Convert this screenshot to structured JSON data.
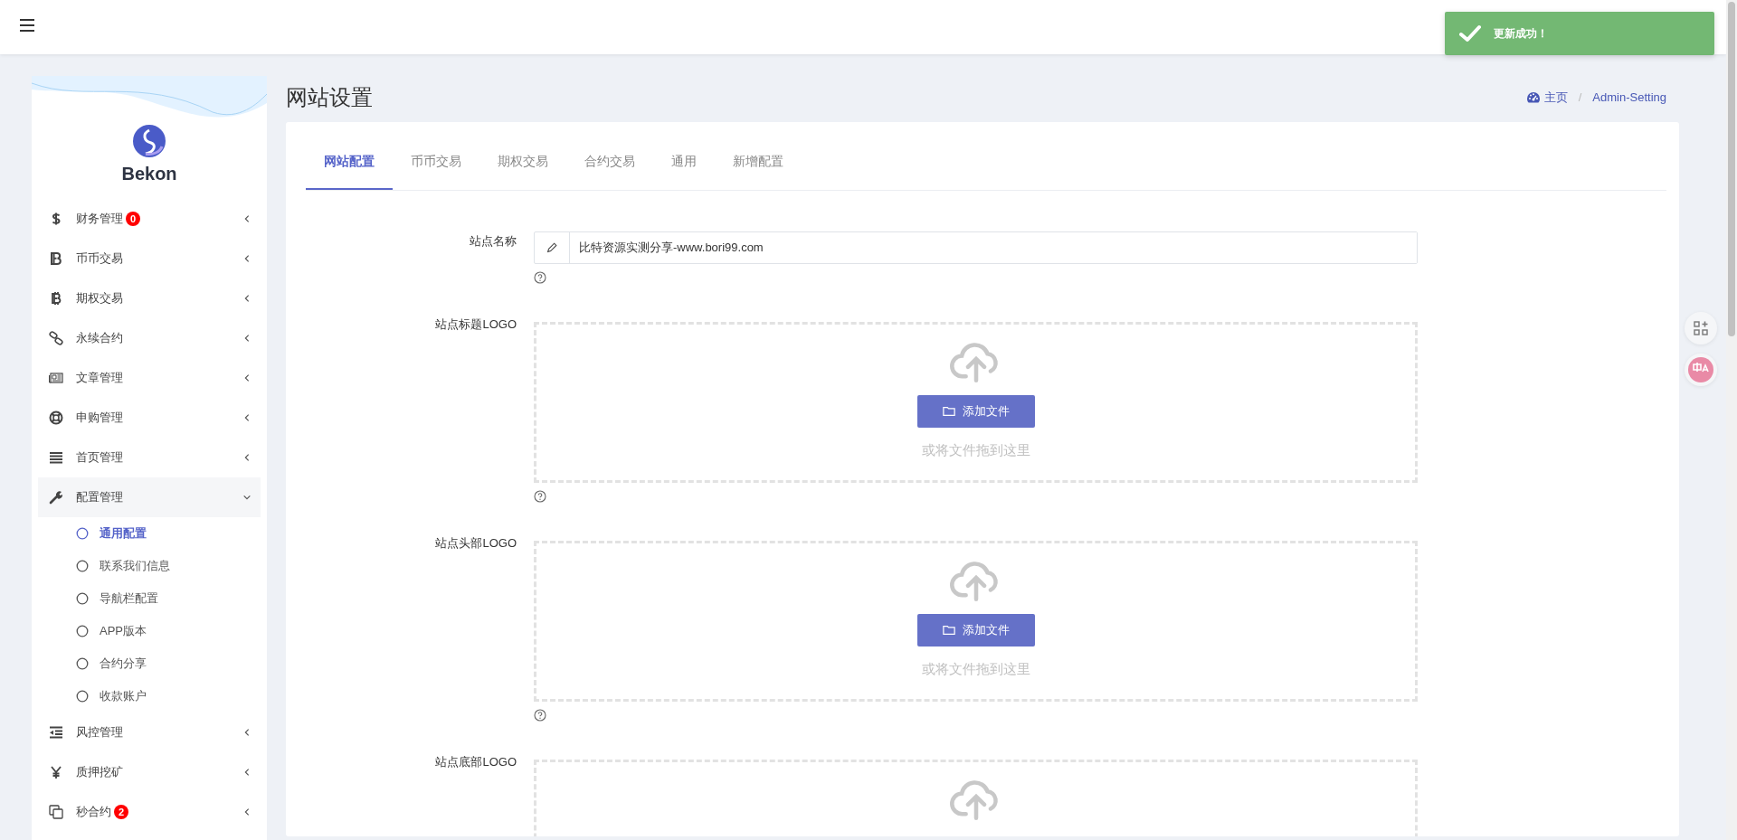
{
  "toast": {
    "message": "更新成功！"
  },
  "sidebar": {
    "brand": "Bekon",
    "items": [
      {
        "label": "财务管理",
        "badge": "0",
        "expanded": false
      },
      {
        "label": "币币交易",
        "expanded": false
      },
      {
        "label": "期权交易",
        "expanded": false
      },
      {
        "label": "永续合约",
        "expanded": false
      },
      {
        "label": "文章管理",
        "expanded": false
      },
      {
        "label": "申购管理",
        "expanded": false
      },
      {
        "label": "首页管理",
        "expanded": false
      },
      {
        "label": "配置管理",
        "expanded": true,
        "children": [
          {
            "label": "通用配置",
            "selected": true
          },
          {
            "label": "联系我们信息",
            "selected": false
          },
          {
            "label": "导航栏配置",
            "selected": false
          },
          {
            "label": "APP版本",
            "selected": false
          },
          {
            "label": "合约分享",
            "selected": false
          },
          {
            "label": "收款账户",
            "selected": false
          }
        ]
      },
      {
        "label": "风控管理",
        "expanded": false
      },
      {
        "label": "质押挖矿",
        "expanded": false
      },
      {
        "label": "秒合约",
        "badge": "2",
        "expanded": false
      }
    ]
  },
  "page": {
    "title": "网站设置",
    "breadcrumb": [
      {
        "label": "主页"
      },
      {
        "label": "Admin-Setting"
      }
    ],
    "breadcrumb_separator": "/"
  },
  "tabs": [
    {
      "label": "网站配置",
      "selected": true
    },
    {
      "label": "币币交易",
      "selected": false
    },
    {
      "label": "期权交易",
      "selected": false
    },
    {
      "label": "合约交易",
      "selected": false
    },
    {
      "label": "通用",
      "selected": false
    },
    {
      "label": "新增配置",
      "selected": false
    }
  ],
  "form": {
    "fields": [
      {
        "kind": "text",
        "label": "站点名称",
        "value": "比特资源实测分享-www.bori99.com"
      },
      {
        "kind": "upload",
        "label": "站点标题LOGO",
        "button": "添加文件",
        "hint": "或将文件拖到这里"
      },
      {
        "kind": "upload",
        "label": "站点头部LOGO",
        "button": "添加文件",
        "hint": "或将文件拖到这里"
      },
      {
        "kind": "upload",
        "label": "站点底部LOGO"
      }
    ]
  }
}
